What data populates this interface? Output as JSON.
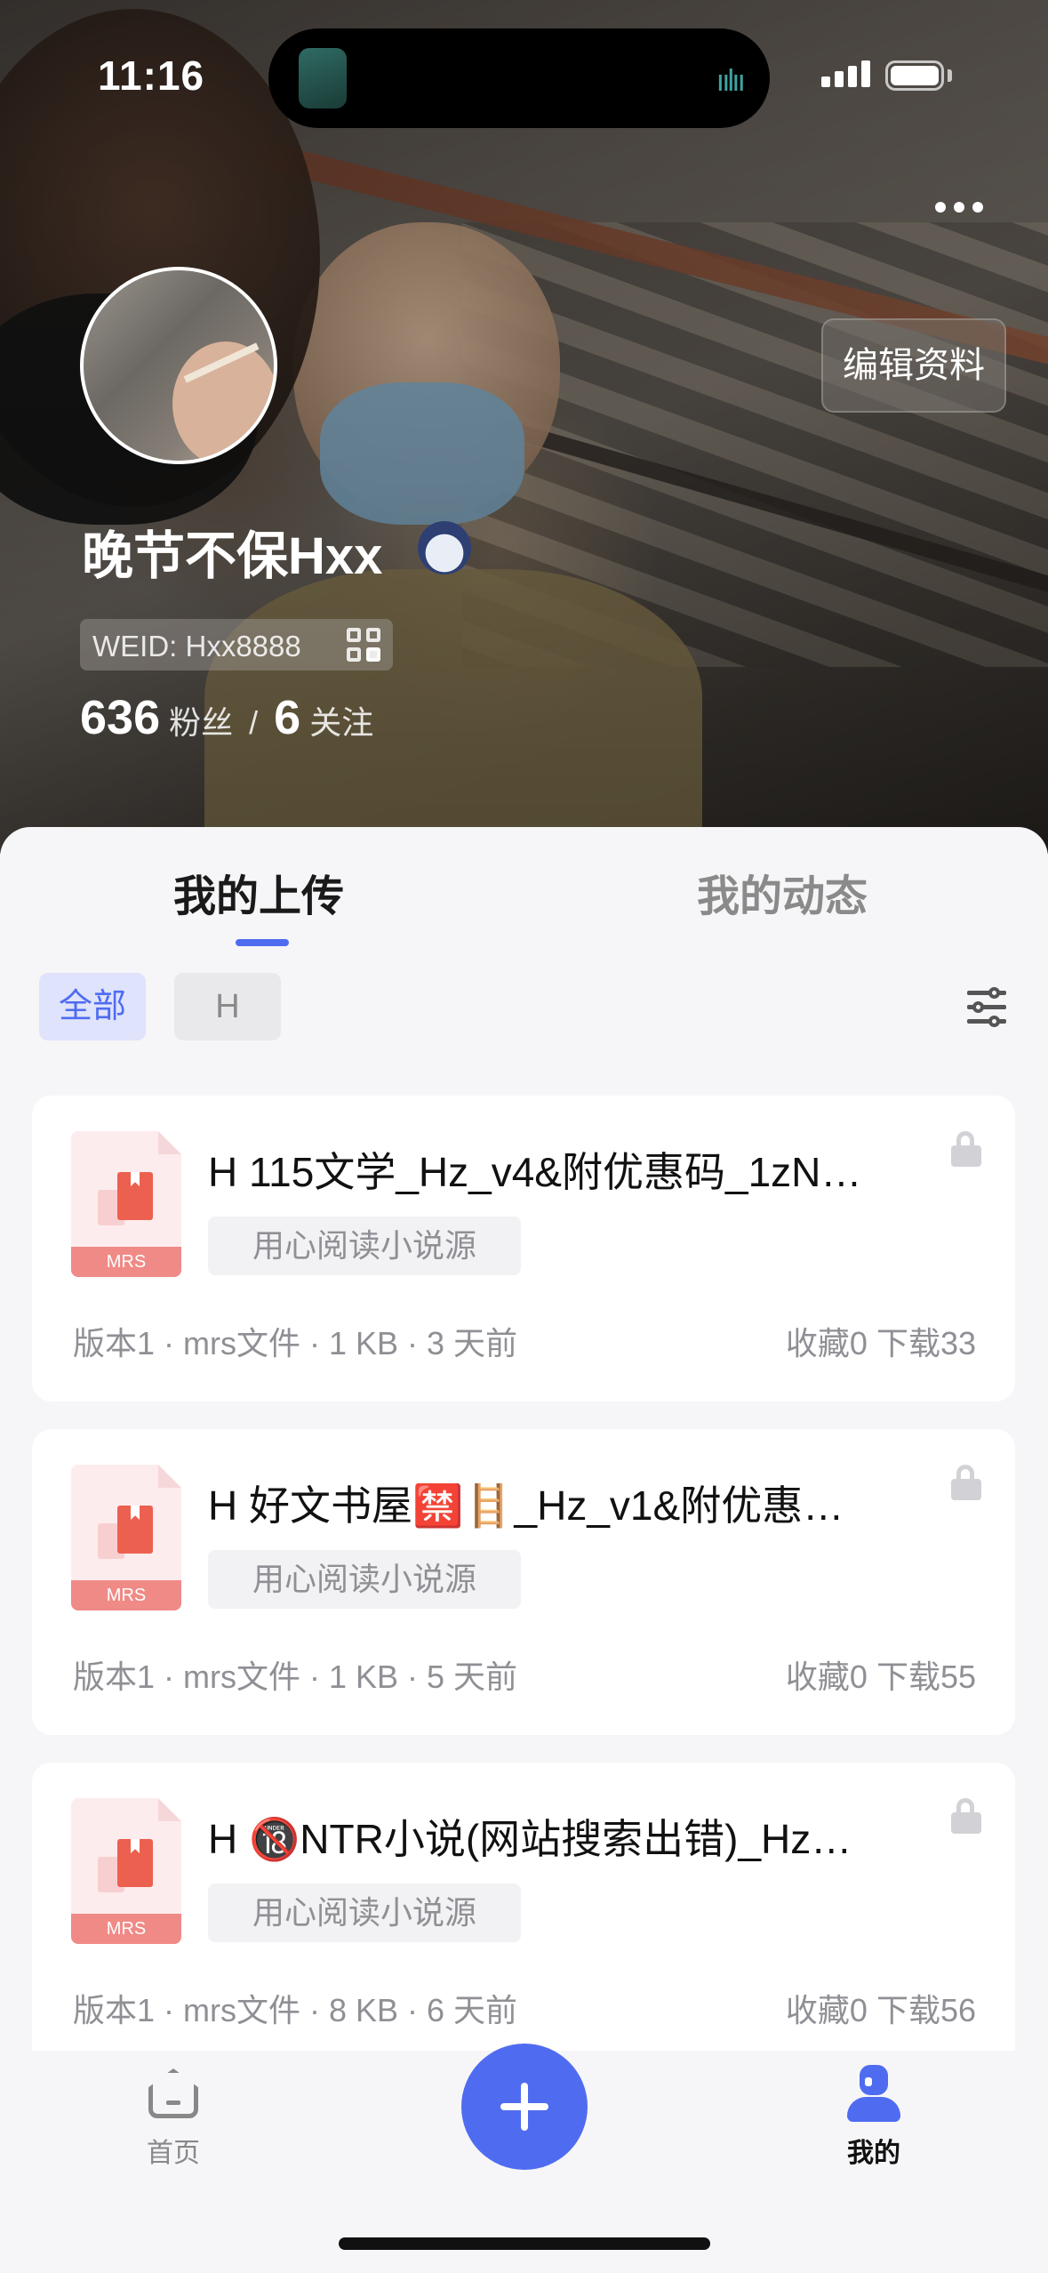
{
  "status_bar": {
    "time": "11:16"
  },
  "profile": {
    "edit_label": "编辑资料",
    "name": "晚节不保Hxx",
    "weid": "WEID: Hxx8888",
    "followers": "636",
    "followers_label": "粉丝",
    "separator": "/",
    "following": "6",
    "following_label": "关注"
  },
  "tabs": [
    {
      "label": "我的上传",
      "active": true
    },
    {
      "label": "我的动态",
      "active": false
    }
  ],
  "filters": [
    {
      "label": "全部",
      "active": true
    },
    {
      "label": "H",
      "active": false
    }
  ],
  "uploads": [
    {
      "title": "H 115文学_Hz_v4&附优惠码_1zN…",
      "file_type": "MRS",
      "tag": "用心阅读小说源",
      "meta": "版本1 · mrs文件 · 1 KB · 3 天前",
      "stats": "收藏0 下载33"
    },
    {
      "title": "H 好文书屋🈲🪜_Hz_v1&附优惠…",
      "file_type": "MRS",
      "tag": "用心阅读小说源",
      "meta": "版本1 · mrs文件 · 1 KB · 5 天前",
      "stats": "收藏0 下载55"
    },
    {
      "title": "H 🔞NTR小说(网站搜索出错)_Hz…",
      "file_type": "MRS",
      "tag": "用心阅读小说源",
      "meta": "版本1 · mrs文件 · 8 KB · 6 天前",
      "stats": "收藏0 下载56"
    }
  ],
  "nav": {
    "home_label": "首页",
    "me_label": "我的",
    "accent": "#4f6cf0"
  },
  "icons": [
    "more-icon",
    "qr-code-icon",
    "filter-icon",
    "lock-icon",
    "file-icon",
    "home-icon",
    "plus-icon",
    "user-icon"
  ]
}
